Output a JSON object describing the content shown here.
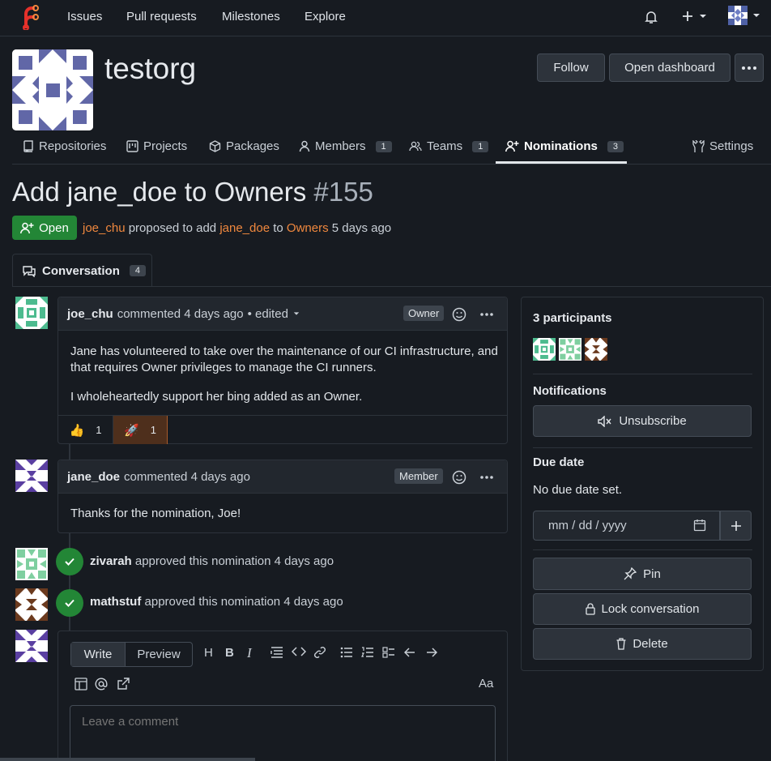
{
  "nav": {
    "items": [
      "Issues",
      "Pull requests",
      "Milestones",
      "Explore"
    ]
  },
  "org": {
    "name": "testorg",
    "follow_label": "Follow",
    "dashboard_label": "Open dashboard"
  },
  "tabs": {
    "repositories": "Repositories",
    "projects": "Projects",
    "packages": "Packages",
    "members": "Members",
    "members_count": "1",
    "teams": "Teams",
    "teams_count": "1",
    "nominations": "Nominations",
    "nominations_count": "3",
    "settings": "Settings"
  },
  "issue": {
    "title": "Add jane_doe to Owners",
    "number": "#155",
    "status": "Open",
    "author": "joe_chu",
    "text_proposed": "proposed to add",
    "nominee": "jane_doe",
    "text_to": "to",
    "team": "Owners",
    "age": "5 days ago"
  },
  "conversation": {
    "label": "Conversation",
    "count": "4"
  },
  "comments": [
    {
      "author": "joe_chu",
      "action": "commented 4 days ago",
      "edited": "• edited",
      "role": "Owner",
      "paragraphs": [
        "Jane has volunteered to take over the maintenance of our CI infrastructure, and that requires Owner privileges to manage the CI runners.",
        "I wholeheartedly support her bing added as an Owner."
      ],
      "reactions": [
        {
          "emoji": "👍",
          "count": "1"
        },
        {
          "emoji": "🚀",
          "count": "1"
        }
      ]
    },
    {
      "author": "jane_doe",
      "action": "commented 4 days ago",
      "role": "Member",
      "paragraphs": [
        "Thanks for the nomination, Joe!"
      ]
    }
  ],
  "events": [
    {
      "user": "zivarah",
      "text": "approved this nomination 4 days ago"
    },
    {
      "user": "mathstuf",
      "text": "approved this nomination 4 days ago"
    }
  ],
  "sidebar": {
    "participants_label": "3 participants",
    "notifications_label": "Notifications",
    "unsubscribe_label": "Unsubscribe",
    "due_date_label": "Due date",
    "no_due_date": "No due date set.",
    "date_placeholder": "mm / dd / yyyy",
    "pin_label": "Pin",
    "lock_label": "Lock conversation",
    "delete_label": "Delete"
  },
  "editor": {
    "write_tab": "Write",
    "preview_tab": "Preview",
    "font_toggle": "Aa",
    "placeholder": "Leave a comment"
  },
  "colors": {
    "accent_green": "#238636",
    "link_orange": "#f0883e",
    "logo_red": "#e5312b"
  }
}
